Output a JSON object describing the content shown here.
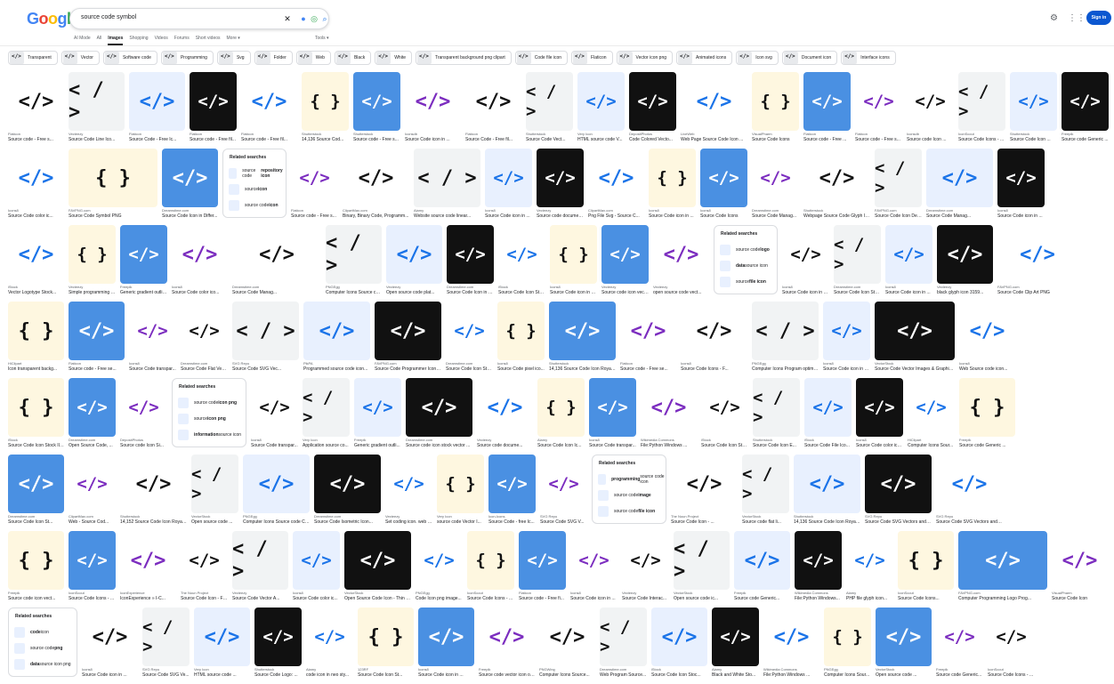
{
  "header": {
    "logo": "Google",
    "search_query": "source code symbol",
    "sign_in_label": "Sign in"
  },
  "tabs": [
    "AI Mode",
    "All",
    "Images",
    "Shopping",
    "Videos",
    "Forums",
    "Short videos",
    "More ▾"
  ],
  "active_tab": "Images",
  "tools_label": "Tools ▾",
  "chips": [
    "Transparent",
    "Vector",
    "Software code",
    "Programming",
    "Svg",
    "Folder",
    "Web",
    "Black",
    "White",
    "Transparent background png clipart",
    "Code file icon",
    "Flaticon",
    "Vector icon png",
    "Animated icons",
    "Icon svg",
    "Document icon",
    "Interface icons"
  ],
  "rows": [
    {
      "cards": [
        {
          "src": "Flaticon",
          "title": "Source code - Free s..."
        },
        {
          "src": "Vecteezy",
          "title": "Source Code Line Ico..."
        },
        {
          "src": "Flaticon",
          "title": "Source Code - Free Ic..."
        },
        {
          "src": "Flaticon",
          "title": "Source code - Free fil..."
        },
        {
          "src": "Flaticon",
          "title": "Source code - Free fil..."
        },
        {
          "src": "Shutterstock",
          "title": "14,136 Source Cod..."
        },
        {
          "src": "Shutterstock",
          "title": "Source code - Free s..."
        },
        {
          "src": "Iconsdb",
          "title": "Source Code icon in ..."
        },
        {
          "src": "Flaticon",
          "title": "Source Code - Free fil..."
        },
        {
          "src": "Shutterstock",
          "title": "Source Code Vect..."
        },
        {
          "src": "Very Icon",
          "title": "HTML source code V..."
        },
        {
          "src": "DepositPhotos",
          "title": "Code Colored Vecto..."
        },
        {
          "src": "LiveWeb",
          "title": "Web Page Source Code Icon ..."
        },
        {
          "src": "VisualPharm",
          "title": "Source Code Icons"
        },
        {
          "src": "Flaticon",
          "title": "Source code - Free ..."
        },
        {
          "src": "Flaticon",
          "title": "Source code - Free s..."
        },
        {
          "src": "Iconsdb",
          "title": "Source code Icon ..."
        },
        {
          "src": "IconScout",
          "title": "Source Code Icons - ..."
        },
        {
          "src": "Shutterstock",
          "title": "Source Code Icon ..."
        },
        {
          "src": "Freepik",
          "title": "Source code Generic ..."
        }
      ]
    },
    {
      "cards": [
        {
          "src": "Icons8",
          "title": "Source Code color ic..."
        },
        {
          "src": "FAVPNG.com",
          "title": "Source Code Symbol PNG"
        },
        {
          "src": "Dreamstime.com",
          "title": "Source Code Icon in Differ..."
        },
        {
          "src": "Flaticon",
          "title": "Source code - Free s..."
        },
        {
          "src": "ClipartMax.com",
          "title": "Binary, Binary Code, Programm..."
        },
        {
          "src": "Alamy",
          "title": "Website source code linear..."
        },
        {
          "src": "Icons8",
          "title": "Source Code icon in ..."
        },
        {
          "src": "Vecteezy",
          "title": "Source code document i..."
        },
        {
          "src": "ClipartMax.com",
          "title": "Png File Svg - Source C..."
        },
        {
          "src": "Icons8",
          "title": "Source Code icon in ..."
        },
        {
          "src": "Icons8",
          "title": "Source Code Icons"
        },
        {
          "src": "Dreamstime.com",
          "title": "Source Code Manag..."
        },
        {
          "src": "Shutterstock",
          "title": "Webpage Source Code Glyph Icon W..."
        },
        {
          "src": "FAVPNG.com",
          "title": "Source Code Icon Design Blog PNG"
        },
        {
          "src": "Dreamstime.com",
          "title": "Source Code Manag..."
        },
        {
          "src": "Icons8",
          "title": "Source Code icon in ..."
        }
      ]
    },
    {
      "cards": [
        {
          "src": "iStock",
          "title": "Vector Logotype Stock..."
        },
        {
          "src": "Vecteezy",
          "title": "Simple programming s..."
        },
        {
          "src": "Freepik",
          "title": "Generic gradient outlin..."
        },
        {
          "src": "Icons8",
          "title": "Source Code color ico..."
        },
        {
          "src": "Dreamstime.com",
          "title": "Source Code Manag..."
        },
        {
          "src": "PNGEgg",
          "title": "Computer Icons Source code ASCII ..."
        },
        {
          "src": "Vecteezy",
          "title": "Open source code plat..."
        },
        {
          "src": "Dreamstime.com",
          "title": "Source Code Icon in D..."
        },
        {
          "src": "iStock",
          "title": "Source Code Icon Sto..."
        },
        {
          "src": "Icons8",
          "title": "Source Code icon in G..."
        },
        {
          "src": "Vecteezy",
          "title": "Source code icon vect..."
        },
        {
          "src": "Vecteezy",
          "title": "open source code vect..."
        },
        {
          "src": "Icons8",
          "title": "Source Code icon in S..."
        },
        {
          "src": "Dreamstime.com",
          "title": "Source Code Icon Sto..."
        },
        {
          "src": "Icons8",
          "title": "Source Code icon in ..."
        },
        {
          "src": "Vecteezy",
          "title": "black glyph icon 3159..."
        },
        {
          "src": "FAVPNG.com",
          "title": "Source Code Clip Art PNG"
        }
      ]
    },
    {
      "cards": [
        {
          "src": "HiClipart",
          "title": "Icon transparent backg..."
        },
        {
          "src": "Flaticon",
          "title": "Source code - Free se..."
        },
        {
          "src": "Icons8",
          "title": "Source Code transpar..."
        },
        {
          "src": "Dreamstime.com",
          "title": "Source Code Flat Vect..."
        },
        {
          "src": "SVG Repo",
          "title": "Source Code SVG Vec..."
        },
        {
          "src": "PikPA",
          "title": "Programmed source code icon..."
        },
        {
          "src": "FAVPNG.com",
          "title": "Source Code Programmer Icon Desi..."
        },
        {
          "src": "Dreamstime.com",
          "title": "Source Code Icon Sto..."
        },
        {
          "src": "Icons8",
          "title": "Source Code pixel ico..."
        },
        {
          "src": "Shutterstock",
          "title": "14,136 Source Code Icon Royalty-Free..."
        },
        {
          "src": "Flaticon",
          "title": "Source code - Free se..."
        },
        {
          "src": "Icons8",
          "title": "Source Code Icons - F..."
        },
        {
          "src": "PNGEgg",
          "title": "Computer Icons Program optimization ..."
        },
        {
          "src": "Icons8",
          "title": "Source Code icon in C..."
        },
        {
          "src": "VectorStock",
          "title": "Source Code Vector Images & Graphics ..."
        },
        {
          "src": "Icons8",
          "title": "Web Source code icon..."
        }
      ]
    },
    {
      "cards": [
        {
          "src": "iStock",
          "title": "Source Code Icon Stock Illustrations ..."
        },
        {
          "src": "Dreamstime.com",
          "title": "Open Source Code, ..."
        },
        {
          "src": "DepositPhotos",
          "title": "Source code Icon Si..."
        },
        {
          "src": "Icons8",
          "title": "Source Code transpar..."
        },
        {
          "src": "Very Icon",
          "title": "Application source co..."
        },
        {
          "src": "Freepik",
          "title": "Generic gradient outli..."
        },
        {
          "src": "Dreamstime.com",
          "title": "Source code icon stock vector ..."
        },
        {
          "src": "Vecteezy",
          "title": "Source code docume..."
        },
        {
          "src": "Alamy",
          "title": "Source Code Icon Ic..."
        },
        {
          "src": "Icons8",
          "title": "Source Code transpar..."
        },
        {
          "src": "Wikimedia Commons",
          "title": "File:Python Windows ..."
        },
        {
          "src": "iStock",
          "title": "Source Code Icon Sto..."
        },
        {
          "src": "Shutterstock",
          "title": "Source Code Icon E..."
        },
        {
          "src": "iStock",
          "title": "Source Code File Ico..."
        },
        {
          "src": "Icons8",
          "title": "Source Code color ico..."
        },
        {
          "src": "HiClipart",
          "title": "Computer Icons Sour..."
        },
        {
          "src": "Freepik",
          "title": "Source code Generic ..."
        }
      ]
    },
    {
      "cards": [
        {
          "src": "Dreamstime.com",
          "title": "Source Code Icon St..."
        },
        {
          "src": "ClipartMax.com",
          "title": "Web - Source Cod..."
        },
        {
          "src": "Shutterstock",
          "title": "14,152 Source Code Icon Royalty-Fre..."
        },
        {
          "src": "VectorStock",
          "title": "Open source code ..."
        },
        {
          "src": "PNGEgg",
          "title": "Computer Icons Source code Compu..."
        },
        {
          "src": "Dreamstime.com",
          "title": "Source Code Isometric Icon..."
        },
        {
          "src": "Vecteezy",
          "title": "Set coding icon. web program me..."
        },
        {
          "src": "Very Icon",
          "title": "source code Vector I..."
        },
        {
          "src": "Icon-Icons",
          "title": "Source Code - free Ic..."
        },
        {
          "src": "SVG Repo",
          "title": "Source Code SVG V..."
        },
        {
          "src": "The Noun Project",
          "title": "Source Code Icon - ..."
        },
        {
          "src": "VectorStock",
          "title": "Source code flat li..."
        },
        {
          "src": "Shutterstock",
          "title": "14,136 Source Code Icon Royalty-Free ..."
        },
        {
          "src": "SVG Repo",
          "title": "Source Code SVG Vectors and Ic..."
        },
        {
          "src": "SVG Repo",
          "title": "Source Code SVG Vectors and Ic..."
        }
      ]
    },
    {
      "cards": [
        {
          "src": "Freepik",
          "title": "Source code icon vect..."
        },
        {
          "src": "IconScout",
          "title": "Source Code Icons - ..."
        },
        {
          "src": "IconExperience",
          "title": "IconExperience » I-C..."
        },
        {
          "src": "The Noun Project",
          "title": "Source Code Icon - Fr..."
        },
        {
          "src": "Vecteezy",
          "title": "Source Code Vector A..."
        },
        {
          "src": "Icons8",
          "title": "Source Code color ic..."
        },
        {
          "src": "VectorStock",
          "title": "Open Source Code Icon - Thin Line ..."
        },
        {
          "src": "PNGEgg",
          "title": "Code Icon png image..."
        },
        {
          "src": "IconScout",
          "title": "Source Code Icons - ..."
        },
        {
          "src": "Flaticon",
          "title": "Source code - Free fi..."
        },
        {
          "src": "Icons8",
          "title": "Source Code icon in ..."
        },
        {
          "src": "Vecteezy",
          "title": "Source Code Interac..."
        },
        {
          "src": "VectorStock",
          "title": "Open source code ic..."
        },
        {
          "src": "Freepik",
          "title": "Source code Generic..."
        },
        {
          "src": "Wikimedia Commons",
          "title": "File:Python Windows..."
        },
        {
          "src": "Alamy",
          "title": "PHP file glyph icon..."
        },
        {
          "src": "IconScout",
          "title": "Source Code Icons..."
        },
        {
          "src": "FAVPNG.com",
          "title": "Computer Programming Logo Prog..."
        },
        {
          "src": "VisualPharm",
          "title": "Source Code Icon"
        }
      ]
    },
    {
      "cards": [
        {
          "src": "Icons8",
          "title": "Source Code icon in ..."
        },
        {
          "src": "SVG Repo",
          "title": "Source Code SVG Ve..."
        },
        {
          "src": "Very Icon",
          "title": "HTML source code ..."
        },
        {
          "src": "Shutterstock",
          "title": "Source Code Logo: ..."
        },
        {
          "src": "Alamy",
          "title": "code icon in neo sty..."
        },
        {
          "src": "123RF",
          "title": "Source Code Icon St..."
        },
        {
          "src": "Icons8",
          "title": "Source Code icon in ..."
        },
        {
          "src": "Freepik",
          "title": "Source code vector icon outline file ..."
        },
        {
          "src": "PNGWing",
          "title": "Computer Icons Source..."
        },
        {
          "src": "Dreamstime.com",
          "title": "Web Program Source..."
        },
        {
          "src": "iStock",
          "title": "Source Code Icon Stoc..."
        },
        {
          "src": "Alamy",
          "title": "Black and White Sto..."
        },
        {
          "src": "Wikimedia Commons",
          "title": "File:Python Windows ..."
        },
        {
          "src": "PNGEgg",
          "title": "Computer Icons Sour..."
        },
        {
          "src": "VectorStock",
          "title": "Open source code ..."
        },
        {
          "src": "Freepik",
          "title": "Source code Generic..."
        },
        {
          "src": "IconScout",
          "title": "Source Code Icons - ..."
        }
      ]
    }
  ],
  "related_searches": [
    {
      "header": "Related searches",
      "items": [
        {
          "prefix": "source code ",
          "bold": "repository icon"
        },
        {
          "prefix": "source ",
          "bold": "icon"
        },
        {
          "prefix": "source code ",
          "bold": "icon"
        }
      ]
    },
    {
      "header": "Related searches",
      "items": [
        {
          "prefix": "source code ",
          "bold": "logo"
        },
        {
          "prefix": "",
          "bold": "data",
          "suffix": " source icon"
        },
        {
          "prefix": "source ",
          "bold": "file icon"
        }
      ]
    },
    {
      "header": "Related searches",
      "items": [
        {
          "prefix": "source code ",
          "bold": "icon png"
        },
        {
          "prefix": "source ",
          "bold": "icon png"
        },
        {
          "prefix": "",
          "bold": "information",
          "suffix": " source icon"
        }
      ]
    },
    {
      "header": "Related searches",
      "items": [
        {
          "prefix": "",
          "bold": "programming",
          "suffix": " source code icon"
        },
        {
          "prefix": "source code ",
          "bold": "image"
        },
        {
          "prefix": "source code ",
          "bold": "file icon"
        }
      ]
    },
    {
      "header": "Related searches",
      "items": [
        {
          "prefix": "",
          "bold": "code",
          "suffix": " icon"
        },
        {
          "prefix": "source code ",
          "bold": "png"
        },
        {
          "prefix": "",
          "bold": "data",
          "suffix": " source icon png"
        }
      ]
    }
  ],
  "colors": {
    "accent": "#0b57d0",
    "chip_border": "#dadce0",
    "thumb_bg": "#f1f3f4",
    "code_blue": "#1a73e8",
    "code_black": "#111111"
  }
}
